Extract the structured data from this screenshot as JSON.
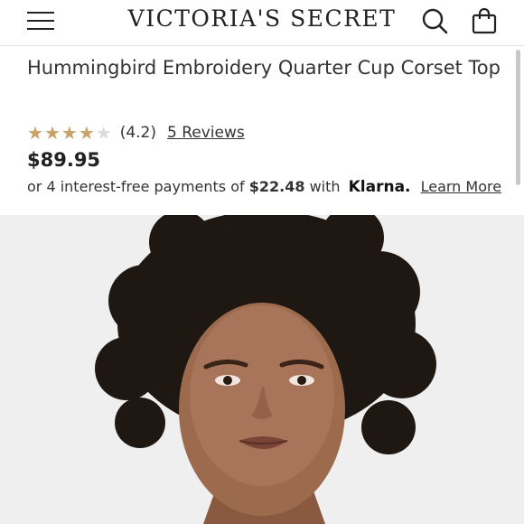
{
  "header": {
    "brand": "VICTORIA'S SECRET",
    "menu_icon": "hamburger-menu-icon",
    "search_icon": "search-icon",
    "bag_icon": "shopping-bag-icon"
  },
  "product": {
    "title": "Hummingbird Embroidery Quarter Cup Corset Top",
    "rating_value": "(4.2)",
    "rating_stars": 4.2,
    "reviews_link": "5 Reviews",
    "price": "$89.95",
    "klarna": {
      "prefix": "or 4 interest-free payments of",
      "amount": "$22.48",
      "with": "with",
      "provider": "Klarna.",
      "learn_more": "Learn More"
    }
  },
  "colors": {
    "star": "#c9a266",
    "text": "#222222"
  },
  "image": {
    "subject": "model-photo"
  }
}
